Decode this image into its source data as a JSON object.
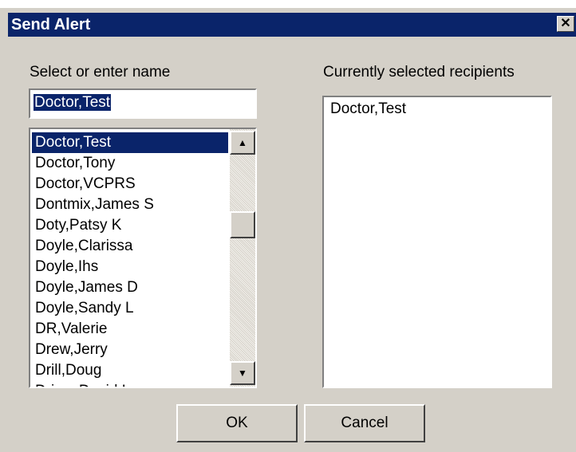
{
  "window": {
    "title": "Send Alert",
    "close_glyph": "✕"
  },
  "left": {
    "label": "Select or enter name",
    "input_value": "Doctor,Test",
    "list_items": [
      "Doctor,Test",
      "Doctor,Tony",
      "Doctor,VCPRS",
      "Dontmix,James S",
      "Doty,Patsy K",
      "Doyle,Clarissa",
      "Doyle,Ihs",
      "Doyle,James D",
      "Doyle,Sandy L",
      "DR,Valerie",
      "Drew,Jerry",
      "Drill,Doug",
      "Driver,David L"
    ],
    "selected_index": 0,
    "scroll_up_glyph": "▲",
    "scroll_down_glyph": "▼"
  },
  "right": {
    "label": "Currently selected recipients",
    "items": [
      "Doctor,Test"
    ]
  },
  "buttons": {
    "ok": "OK",
    "cancel": "Cancel"
  },
  "colors": {
    "titlebar": "#0a246a",
    "selection": "#0a246a",
    "face": "#d4d0c8"
  }
}
